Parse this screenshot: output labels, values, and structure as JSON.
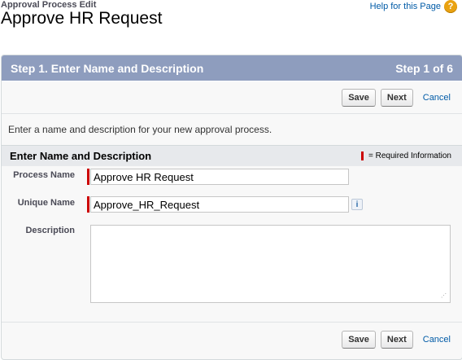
{
  "header": {
    "breadcrumb": "Approval Process Edit",
    "title": "Approve HR Request",
    "help_link": "Help for this Page",
    "help_icon": "?"
  },
  "step": {
    "title": "Step 1. Enter Name and Description",
    "counter": "Step 1 of 6"
  },
  "buttons": {
    "save": "Save",
    "next": "Next",
    "cancel": "Cancel"
  },
  "intro_text": "Enter a name and description for your new approval process.",
  "section": {
    "title": "Enter Name and Description",
    "legend": "= Required Information"
  },
  "form": {
    "process_name_label": "Process Name",
    "process_name_value": "Approve HR Request",
    "unique_name_label": "Unique Name",
    "unique_name_value": "Approve_HR_Request",
    "info_icon": "i",
    "description_label": "Description",
    "description_value": ""
  },
  "colors": {
    "step_header": "#8e9dbe",
    "required": "#cc0000",
    "link": "#015ba7",
    "help_icon": "#e9a211"
  }
}
